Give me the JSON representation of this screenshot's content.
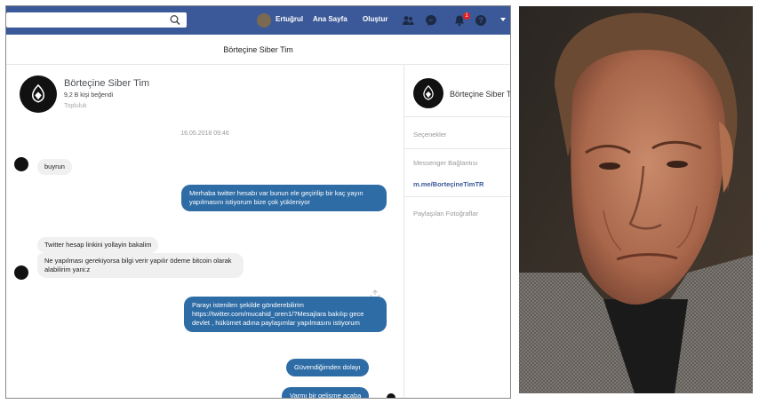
{
  "topbar": {
    "user_name": "Ertuğrul",
    "home_label": "Ana Sayfa",
    "create_label": "Oluştur",
    "notification_count": "1",
    "icons": [
      "search-icon",
      "friends-icon",
      "messenger-icon",
      "notifications-icon",
      "help-icon",
      "chevron-down-icon"
    ]
  },
  "chat": {
    "title": "Börteçine Siber Tim",
    "page_name": "Börteçine Siber Tim",
    "likes": "9,2 B kişi beğendi",
    "type": "Topluluk",
    "timestamp": "16.05.2018 09:46",
    "messages": [
      {
        "from": "page",
        "text": "buyrun"
      },
      {
        "from": "me",
        "text": "Merhaba twitter hesabı var bunun ele geçirilip bir kaç yayın yapılmasını istiyorum bize çok yükleniyor"
      },
      {
        "from": "page",
        "text": "Twitter hesap linkini yollayin bakalim"
      },
      {
        "from": "page",
        "text": "Ne yapılması gerekiyorsa bilgi verir yapılır ödeme bitcoin olarak alabilirim yani:z"
      },
      {
        "from": "me",
        "text": "Parayı istenilen şekilde gönderebilirim https://twitter.com/mucahid_oren1/?Mesajlara bakılıp gece devlet , hükümet adına paylaşımlar yapılmasını istiyorum"
      },
      {
        "from": "me",
        "text": "Güvendiğimden dolayı"
      },
      {
        "from": "me",
        "text": "Varmı bir gelişme acaba"
      }
    ]
  },
  "sidebar": {
    "page_name": "Börteçine Siber T",
    "options_label": "Seçenekler",
    "messenger_link_label": "Messenger Bağlantısı",
    "messenger_link": "m.me/BorteçineTimTR",
    "shared_photos_label": "Paylaşılan Fotoğraflar"
  },
  "colors": {
    "facebook_blue": "#3b5998",
    "outgoing_bubble": "#2e6ca6",
    "incoming_bubble": "#f1f0f0"
  }
}
